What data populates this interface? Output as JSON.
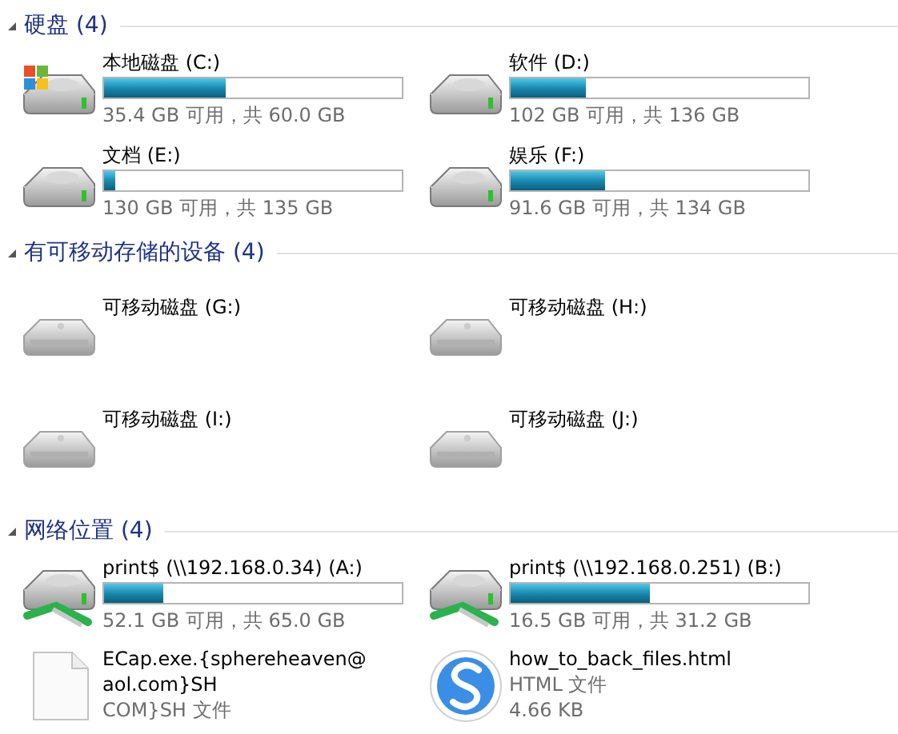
{
  "groups": [
    {
      "title": "硬盘 (4)",
      "expanded": true,
      "items": [
        {
          "kind": "system-drive",
          "name": "本地磁盘 (C:)",
          "level": 0.41,
          "space": "35.4 GB 可用，共 60.0 GB"
        },
        {
          "kind": "drive",
          "name": "软件 (D:)",
          "level": 0.25,
          "space": "102 GB 可用，共 136 GB"
        },
        {
          "kind": "drive",
          "name": "文档 (E:)",
          "level": 0.037,
          "space": "130 GB 可用，共 135 GB"
        },
        {
          "kind": "drive",
          "name": "娱乐 (F:)",
          "level": 0.316,
          "space": "91.6 GB 可用，共 134 GB"
        }
      ]
    },
    {
      "title": "有可移动存储的设备 (4)",
      "expanded": true,
      "items": [
        {
          "kind": "removable",
          "name": "可移动磁盘 (G:)"
        },
        {
          "kind": "removable",
          "name": "可移动磁盘 (H:)"
        },
        {
          "kind": "removable",
          "name": "可移动磁盘 (I:)"
        },
        {
          "kind": "removable",
          "name": "可移动磁盘 (J:)"
        }
      ]
    },
    {
      "title": "网络位置 (4)",
      "expanded": true,
      "items": [
        {
          "kind": "network-drive",
          "name": "print$ (\\\\192.168.0.34) (A:)",
          "level": 0.2,
          "space": "52.1 GB 可用，共 65.0 GB"
        },
        {
          "kind": "network-drive",
          "name": "print$ (\\\\192.168.0.251) (B:)",
          "level": 0.47,
          "space": "16.5 GB 可用，共 31.2 GB"
        },
        {
          "kind": "file",
          "name": "ECap.exe.{sphereheaven@aol.com}SH",
          "type": "COM}SH 文件"
        },
        {
          "kind": "html-file",
          "name": "how_to_back_files.html",
          "type": "HTML 文件",
          "size": "4.66 KB"
        }
      ]
    }
  ]
}
